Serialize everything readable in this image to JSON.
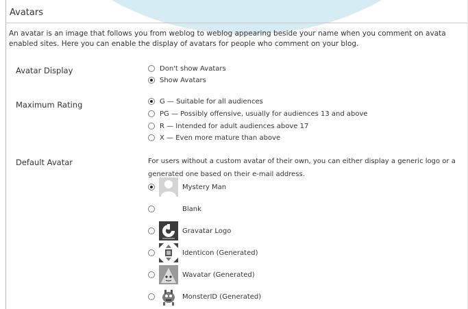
{
  "section": {
    "title": "Avatars"
  },
  "intro": {
    "line1": "An avatar is an image that follows you from weblog to weblog appearing beside your name when you comment on avata",
    "line2": "enabled sites. Here you can enable the display of avatars for people who comment on your blog."
  },
  "avatar_display": {
    "label": "Avatar Display",
    "options": [
      {
        "label": "Don't show Avatars",
        "checked": false
      },
      {
        "label": "Show Avatars",
        "checked": true
      }
    ]
  },
  "maximum_rating": {
    "label": "Maximum Rating",
    "options": [
      {
        "label": "G — Suitable for all audiences",
        "checked": true
      },
      {
        "label": "PG — Possibly offensive, usually for audiences 13 and above",
        "checked": false
      },
      {
        "label": "R — Intended for adult audiences above 17",
        "checked": false
      },
      {
        "label": "X — Even more mature than above",
        "checked": false
      }
    ]
  },
  "default_avatar": {
    "label": "Default Avatar",
    "description_line1": "For users without a custom avatar of their own, you can either display a generic logo or a",
    "description_line2": "generated one based on their e-mail address.",
    "options": [
      {
        "label": "Mystery Man",
        "icon": "mystery-man-icon",
        "checked": true
      },
      {
        "label": "Blank",
        "icon": "blank-avatar",
        "checked": false
      },
      {
        "label": "Gravatar Logo",
        "icon": "gravatar-logo-icon",
        "checked": false
      },
      {
        "label": "Identicon (Generated)",
        "icon": "identicon-icon",
        "checked": false
      },
      {
        "label": "Wavatar (Generated)",
        "icon": "wavatar-icon",
        "checked": false
      },
      {
        "label": "MonsterID (Generated)",
        "icon": "monsterid-icon",
        "checked": false
      }
    ]
  },
  "colors": {
    "background": "#ffffff",
    "swoosh": "#d5ecf4",
    "text": "#333333"
  }
}
